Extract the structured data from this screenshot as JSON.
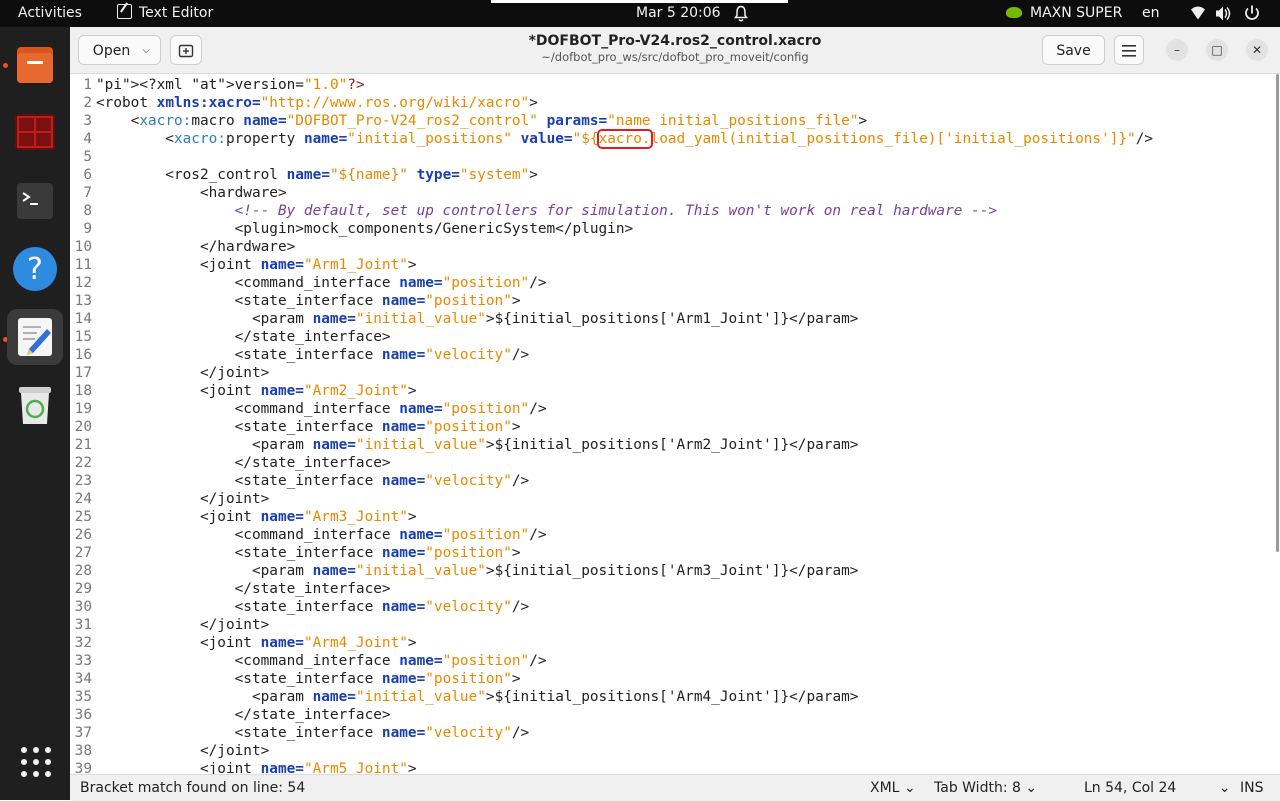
{
  "topbar": {
    "activities": "Activities",
    "app_name": "Text Editor",
    "clock": "Mar 5  20:06",
    "gpu": "MAXN SUPER",
    "lang": "en"
  },
  "dock": {
    "items": [
      "files-icon",
      "terminal-app-icon",
      "console-icon",
      "help-icon",
      "text-editor-icon",
      "trash-icon"
    ]
  },
  "header": {
    "open_label": "Open",
    "save_label": "Save",
    "title": "*DOFBOT_Pro-V24.ros2_control.xacro",
    "subtitle": "~/dofbot_pro_ws/src/dofbot_pro_moveit/config"
  },
  "editor": {
    "line_numbers": [
      "1",
      "2",
      "3",
      "4",
      "5",
      "6",
      "7",
      "8",
      "9",
      "10",
      "11",
      "12",
      "13",
      "14",
      "15",
      "16",
      "17",
      "18",
      "19",
      "20",
      "21",
      "22",
      "23",
      "24",
      "25",
      "26",
      "27",
      "28",
      "29",
      "30",
      "31",
      "32",
      "33",
      "34",
      "35",
      "36",
      "37",
      "38",
      "39"
    ],
    "lines": [
      "<?xml version=\"1.0\"?>",
      "<robot xmlns:xacro=\"http://www.ros.org/wiki/xacro\">",
      "    <xacro:macro name=\"DOFBOT_Pro-V24_ros2_control\" params=\"name initial_positions_file\">",
      "        <xacro:property name=\"initial_positions\" value=\"${xacro.load_yaml(initial_positions_file)['initial_positions']}\"/>",
      "",
      "        <ros2_control name=\"${name}\" type=\"system\">",
      "            <hardware>",
      "                <!-- By default, set up controllers for simulation. This won't work on real hardware -->",
      "                <plugin>mock_components/GenericSystem</plugin>",
      "            </hardware>",
      "            <joint name=\"Arm1_Joint\">",
      "                <command_interface name=\"position\"/>",
      "                <state_interface name=\"position\">",
      "                  <param name=\"initial_value\">${initial_positions['Arm1_Joint']}</param>",
      "                </state_interface>",
      "                <state_interface name=\"velocity\"/>",
      "            </joint>",
      "            <joint name=\"Arm2_Joint\">",
      "                <command_interface name=\"position\"/>",
      "                <state_interface name=\"position\">",
      "                  <param name=\"initial_value\">${initial_positions['Arm2_Joint']}</param>",
      "                </state_interface>",
      "                <state_interface name=\"velocity\"/>",
      "            </joint>",
      "            <joint name=\"Arm3_Joint\">",
      "                <command_interface name=\"position\"/>",
      "                <state_interface name=\"position\">",
      "                  <param name=\"initial_value\">${initial_positions['Arm3_Joint']}</param>",
      "                </state_interface>",
      "                <state_interface name=\"velocity\"/>",
      "            </joint>",
      "            <joint name=\"Arm4_Joint\">",
      "                <command_interface name=\"position\"/>",
      "                <state_interface name=\"position\">",
      "                  <param name=\"initial_value\">${initial_positions['Arm4_Joint']}</param>",
      "                </state_interface>",
      "                <state_interface name=\"velocity\"/>",
      "            </joint>",
      "            <joint name=\"Arm5_Joint\">"
    ],
    "highlight": {
      "line": 4,
      "text": "xacro."
    }
  },
  "status": {
    "message": "Bracket match found on line: 54",
    "language": "XML",
    "tab_width": "Tab Width: 8",
    "position": "Ln 54, Col 24",
    "mode": "INS"
  }
}
